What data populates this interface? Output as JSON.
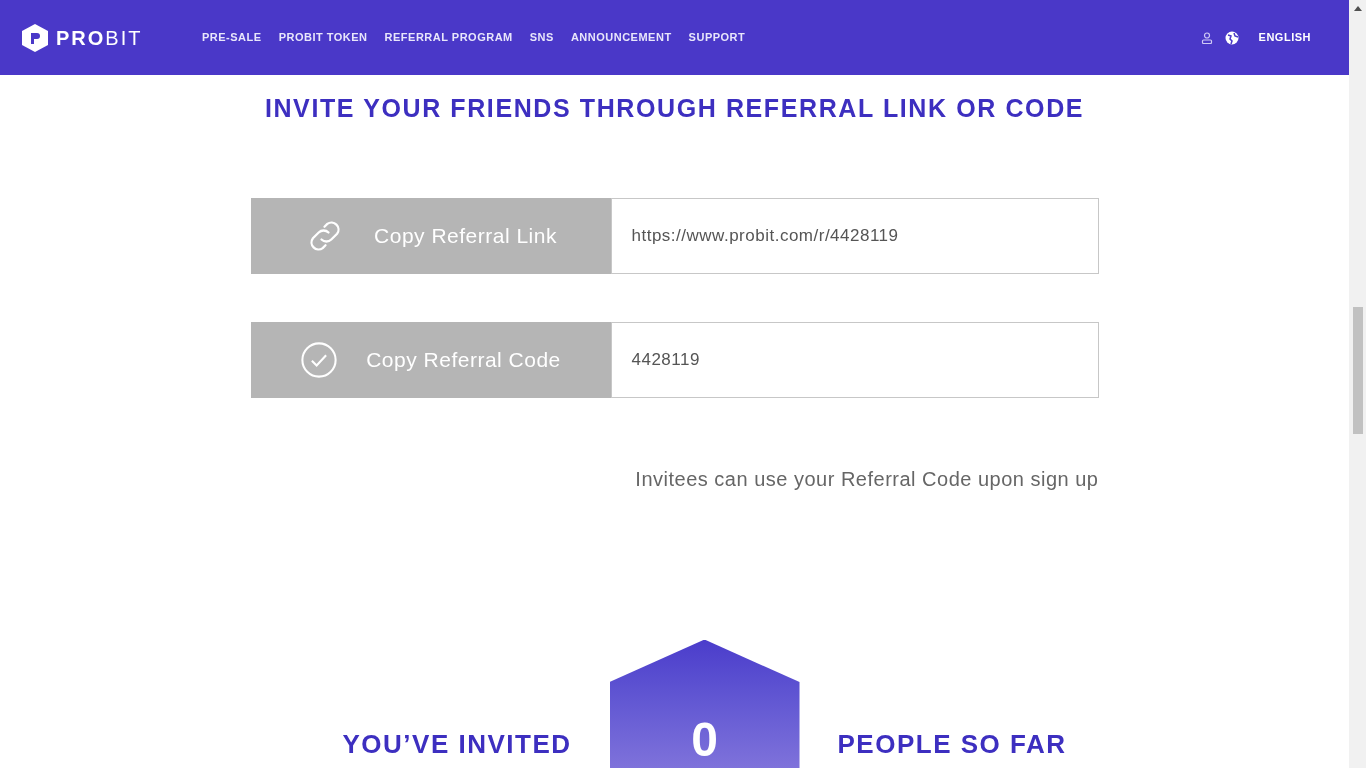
{
  "header": {
    "logo": {
      "bold": "PRO",
      "light": "BIT"
    },
    "nav": [
      {
        "label": "PRE-SALE"
      },
      {
        "label": "PROBIT TOKEN"
      },
      {
        "label": "REFERRAL PROGRAM"
      },
      {
        "label": "SNS"
      },
      {
        "label": "ANNOUNCEMENT"
      },
      {
        "label": "SUPPORT"
      }
    ],
    "language": "ENGLISH"
  },
  "title": "INVITE YOUR FRIENDS THROUGH REFERRAL LINK OR CODE",
  "rows": [
    {
      "kind": "link",
      "button": "Copy Referral Link",
      "value": "https://www.probit.com/r/4428119"
    },
    {
      "kind": "code",
      "button": "Copy Referral Code",
      "value": "4428119"
    }
  ],
  "note": "Invitees can use your Referral Code upon sign up",
  "invited": {
    "before": "YOU’VE INVITED",
    "count": "0",
    "after": "PEOPLE SO FAR"
  }
}
